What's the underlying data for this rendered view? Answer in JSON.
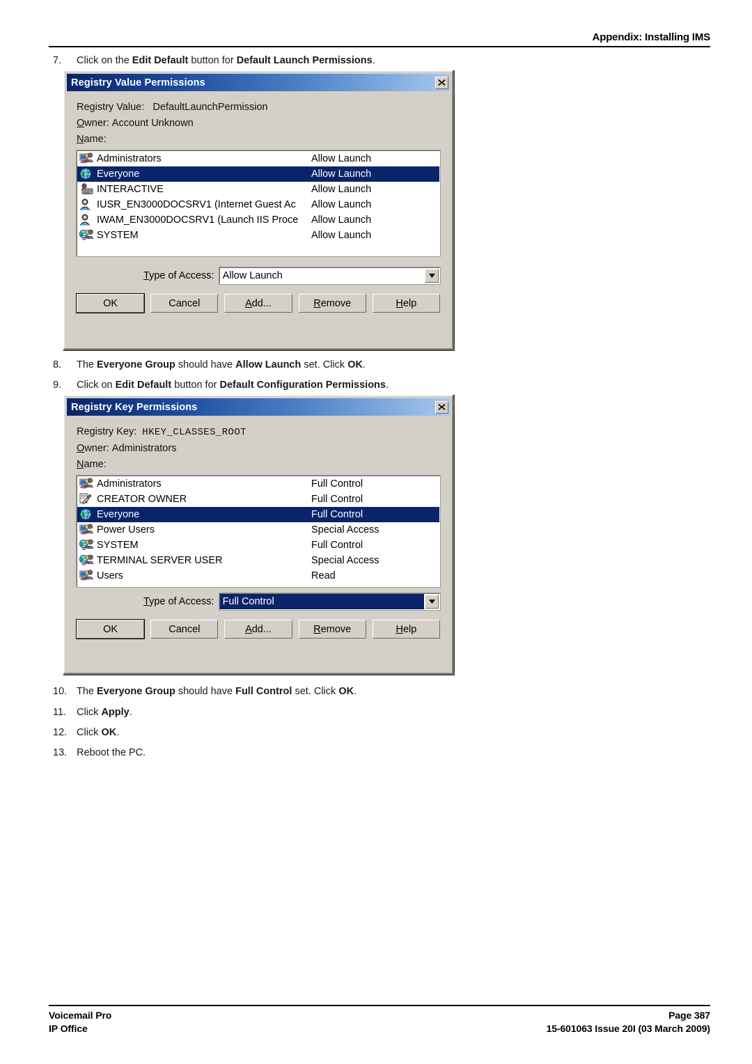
{
  "header": {
    "title": "Appendix: Installing IMS"
  },
  "steps": {
    "s7": {
      "num": "7.",
      "prefix": "Click on the ",
      "b1": "Edit Default",
      "mid": " button for ",
      "b2": "Default Launch Permissions",
      "suffix": "."
    },
    "s8": {
      "num": "8.",
      "prefix": "The ",
      "b1": "Everyone Group",
      "mid": " should have ",
      "b2": "Allow Launch",
      "mid2": " set. Click ",
      "b3": "OK",
      "suffix": "."
    },
    "s9": {
      "num": "9.",
      "prefix": "Click on ",
      "b1": "Edit Default",
      "mid": " button for ",
      "b2": "Default Configuration Permissions",
      "suffix": "."
    },
    "s10": {
      "num": "10.",
      "prefix": "The ",
      "b1": "Everyone Group",
      "mid": " should have ",
      "b2": "Full Control",
      "mid2": " set. Click ",
      "b3": "OK",
      "suffix": "."
    },
    "s11": {
      "num": "11.",
      "prefix": "Click ",
      "b1": "Apply",
      "suffix": "."
    },
    "s12": {
      "num": "12.",
      "prefix": "Click ",
      "b1": "OK",
      "suffix": "."
    },
    "s13": {
      "num": "13.",
      "prefix": "Reboot the PC.",
      "b1": "",
      "suffix": ""
    }
  },
  "dialog_value": {
    "title": "Registry Value Permissions",
    "close_label": "✕",
    "field1_label": "Registry Value:",
    "field1_value": "DefaultLaunchPermission",
    "owner_label_u": "O",
    "owner_label_rest": "wner:",
    "owner_value": "Account Unknown",
    "name_label_u": "N",
    "name_label_rest": "ame:",
    "rows": [
      {
        "icon": "group-icon",
        "name": "Administrators",
        "perm": "Allow Launch",
        "selected": false
      },
      {
        "icon": "everyone-icon",
        "name": "Everyone",
        "perm": "Allow Launch",
        "selected": true
      },
      {
        "icon": "interactive-icon",
        "name": "INTERACTIVE",
        "perm": "Allow Launch",
        "selected": false
      },
      {
        "icon": "user-icon",
        "name": "IUSR_EN3000DOCSRV1 (Internet Guest Ac",
        "perm": "Allow Launch",
        "selected": false
      },
      {
        "icon": "user-icon",
        "name": "IWAM_EN3000DOCSRV1 (Launch IIS Proce",
        "perm": "Allow Launch",
        "selected": false
      },
      {
        "icon": "system-icon",
        "name": "SYSTEM",
        "perm": "Allow Launch",
        "selected": false
      }
    ],
    "access_label_u": "T",
    "access_label_rest": "ype of Access:",
    "access_value": "Allow Launch",
    "access_selected": false,
    "buttons": [
      {
        "name": "ok-button",
        "label": "OK",
        "accel": "",
        "default": true
      },
      {
        "name": "cancel-button",
        "label": "Cancel",
        "accel": "",
        "default": false
      },
      {
        "name": "add-button",
        "label": "Add...",
        "accel": "A",
        "default": false
      },
      {
        "name": "remove-button",
        "label": "Remove",
        "accel": "R",
        "default": false
      },
      {
        "name": "help-button",
        "label": "Help",
        "accel": "H",
        "default": false
      }
    ]
  },
  "dialog_key": {
    "title": "Registry Key Permissions",
    "close_label": "✕",
    "field1_label": "Registry Key:",
    "field1_value": "HKEY_CLASSES_ROOT",
    "owner_label_u": "O",
    "owner_label_rest": "wner:",
    "owner_value": "Administrators",
    "name_label_u": "N",
    "name_label_rest": "ame:",
    "rows": [
      {
        "icon": "group-icon",
        "name": "Administrators",
        "perm": "Full Control",
        "selected": false
      },
      {
        "icon": "creator-owner-icon",
        "name": "CREATOR OWNER",
        "perm": "Full Control",
        "selected": false
      },
      {
        "icon": "everyone-icon",
        "name": "Everyone",
        "perm": "Full Control",
        "selected": true
      },
      {
        "icon": "group-icon",
        "name": "Power Users",
        "perm": "Special Access",
        "selected": false
      },
      {
        "icon": "system-icon",
        "name": "SYSTEM",
        "perm": "Full Control",
        "selected": false
      },
      {
        "icon": "system-icon",
        "name": "TERMINAL SERVER USER",
        "perm": "Special Access",
        "selected": false
      },
      {
        "icon": "group-icon",
        "name": "Users",
        "perm": "Read",
        "selected": false
      }
    ],
    "access_label_u": "T",
    "access_label_rest": "ype of Access:",
    "access_value": "Full Control",
    "access_selected": true,
    "buttons": [
      {
        "name": "ok-button",
        "label": "OK",
        "accel": "",
        "default": true
      },
      {
        "name": "cancel-button",
        "label": "Cancel",
        "accel": "",
        "default": false
      },
      {
        "name": "add-button",
        "label": "Add...",
        "accel": "A",
        "default": false
      },
      {
        "name": "remove-button",
        "label": "Remove",
        "accel": "R",
        "default": false
      },
      {
        "name": "help-button",
        "label": "Help",
        "accel": "H",
        "default": false
      }
    ]
  },
  "footer": {
    "left_line1": "Voicemail Pro",
    "left_line2": "IP Office",
    "right_line1": "Page 387",
    "right_line2": "15-601063 Issue 20I (03 March 2009)"
  },
  "colors": {
    "title_gradient_start": "#0a246a",
    "title_gradient_end": "#a6c8ef",
    "selection": "#0a246a",
    "dialog_face": "#d4d0c8"
  }
}
